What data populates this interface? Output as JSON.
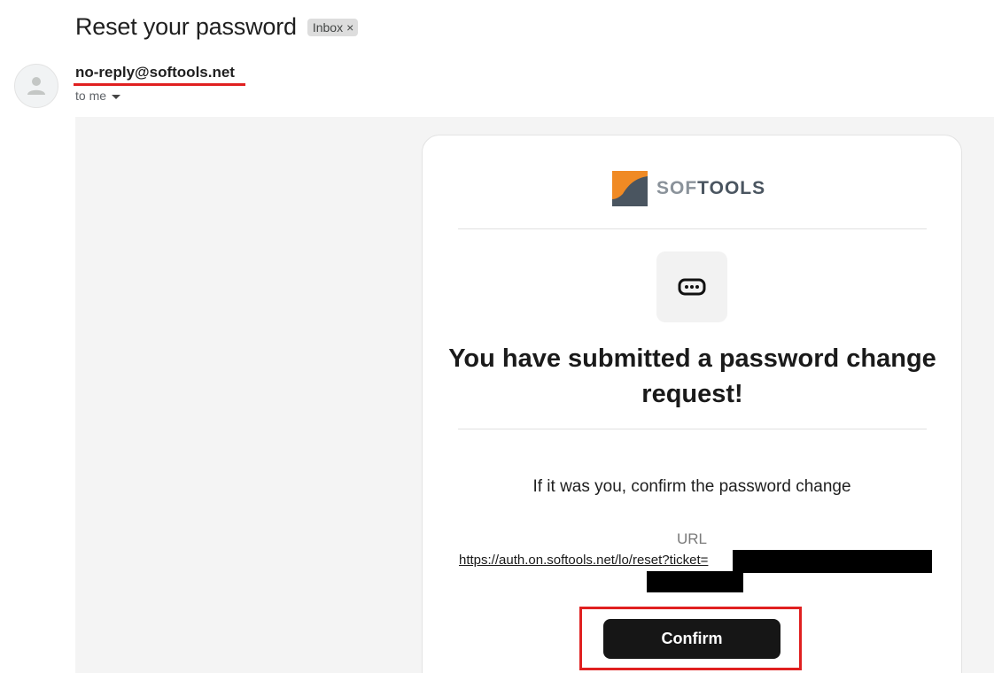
{
  "email": {
    "subject": "Reset your password",
    "label_chip": "Inbox",
    "label_chip_close": "×",
    "sender": "no-reply@softools.net",
    "recipient": "to me"
  },
  "body": {
    "logo": {
      "prefix": "SOF",
      "suffix": "TOOLS"
    },
    "heading": "You have submitted a password change request!",
    "instruction": "If it was you, confirm the password change",
    "url_label": "URL",
    "url": "https://auth.on.softools.net/lo/reset?ticket=",
    "confirm_label": "Confirm"
  },
  "colors": {
    "annotation_red": "#e02020",
    "logo_orange": "#f08a24",
    "logo_slate": "#4a5560",
    "button_bg": "#161616"
  },
  "icons": [
    "person-avatar-icon",
    "chevron-down-icon",
    "softools-logo-mark",
    "password-dots-icon"
  ]
}
